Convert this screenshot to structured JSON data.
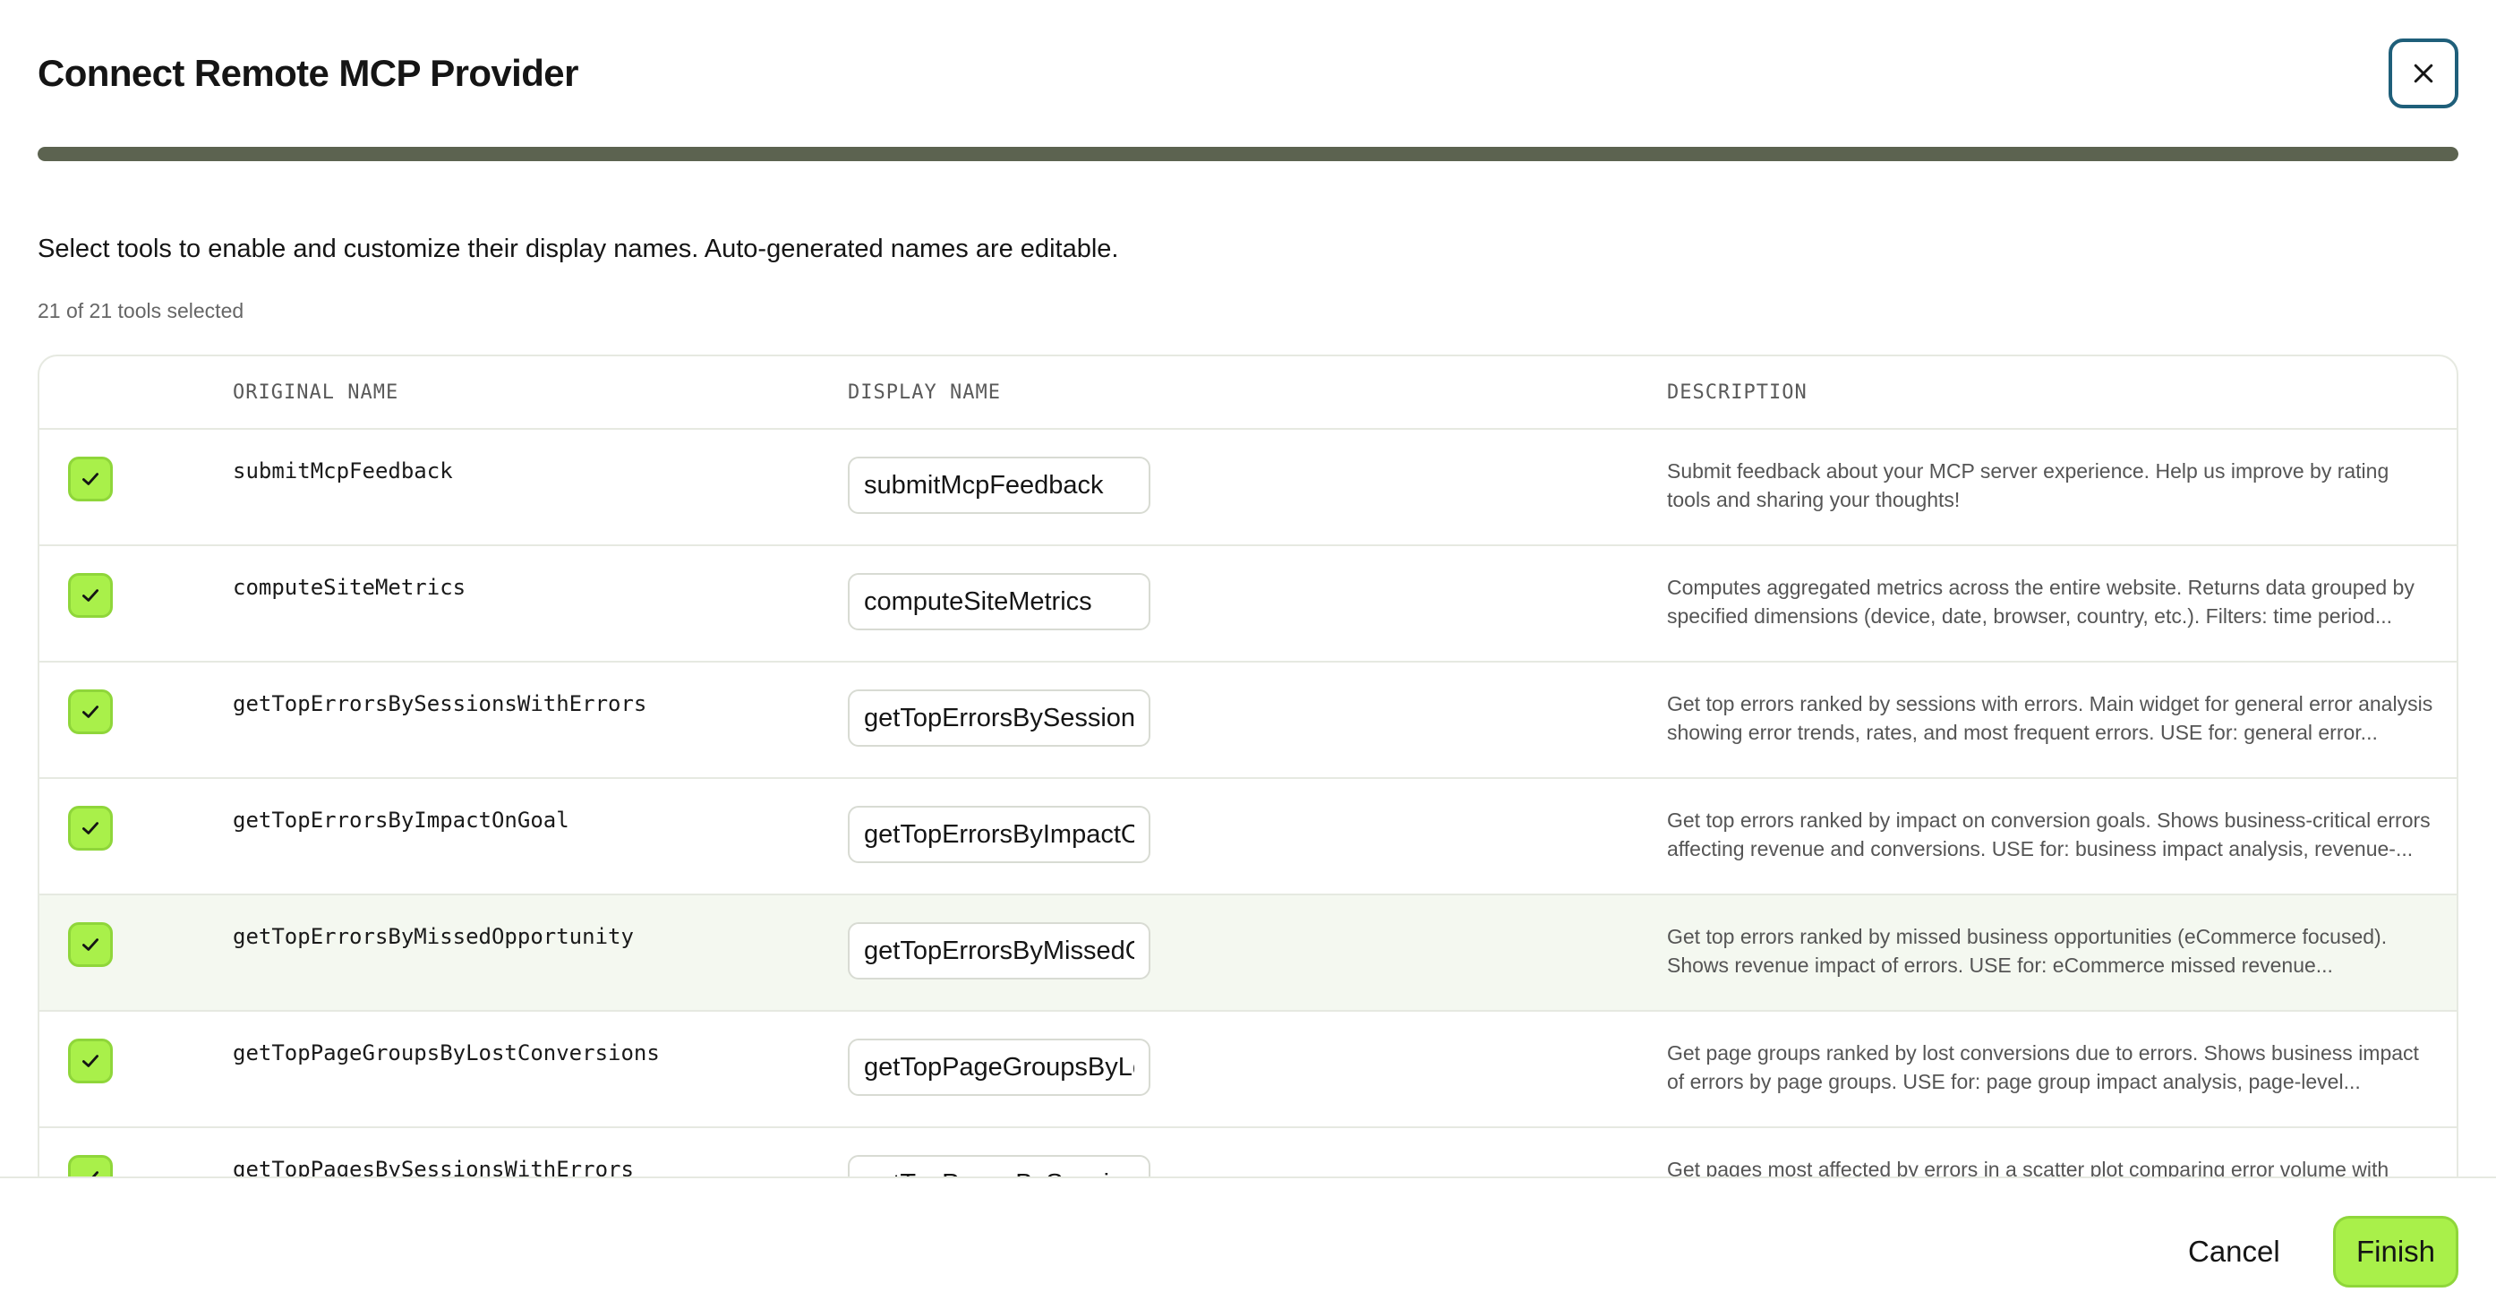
{
  "dialog": {
    "title": "Connect Remote MCP Provider",
    "progress_fraction": 1.0,
    "intro": "Select tools to enable and customize their display names. Auto-generated names are editable.",
    "selected_count": "21 of 21 tools selected"
  },
  "table": {
    "headers": {
      "original": "ORIGINAL NAME",
      "display": "DISPLAY NAME",
      "description": "DESCRIPTION"
    },
    "rows": [
      {
        "checked": true,
        "original": "submitMcpFeedback",
        "display": "submitMcpFeedback",
        "description": "Submit feedback about your MCP server experience. Help us improve by rating tools and sharing your thoughts!"
      },
      {
        "checked": true,
        "original": "computeSiteMetrics",
        "display": "computeSiteMetrics",
        "description": "Computes aggregated metrics across the entire website. Returns data grouped by specified dimensions (device, date, browser, country, etc.). Filters: time period..."
      },
      {
        "checked": true,
        "original": "getTopErrorsBySessionsWithErrors",
        "display": "getTopErrorsBySessionsWithErrors",
        "description": "Get top errors ranked by sessions with errors. Main widget for general error analysis showing error trends, rates, and most frequent errors. USE for: general error..."
      },
      {
        "checked": true,
        "original": "getTopErrorsByImpactOnGoal",
        "display": "getTopErrorsByImpactOnGoal",
        "description": "Get top errors ranked by impact on conversion goals. Shows business-critical errors affecting revenue and conversions. USE for: business impact analysis, revenue-..."
      },
      {
        "checked": true,
        "original": "getTopErrorsByMissedOpportunity",
        "display": "getTopErrorsByMissedOpportunity",
        "description": "Get top errors ranked by missed business opportunities (eCommerce focused). Shows revenue impact of errors. USE for: eCommerce missed revenue..."
      },
      {
        "checked": true,
        "original": "getTopPageGroupsByLostConversions",
        "display": "getTopPageGroupsByLostConversions",
        "description": "Get page groups ranked by lost conversions due to errors. Shows business impact of errors by page groups. USE for: page group impact analysis, page-level..."
      },
      {
        "checked": true,
        "original": "getTopPagesBySessionsWithErrors",
        "display": "getTopPagesBySessionsWithErrors",
        "description": "Get pages most affected by errors in a scatter plot comparing error volume with"
      }
    ]
  },
  "footer": {
    "cancel_label": "Cancel",
    "finish_label": "Finish"
  },
  "colors": {
    "accent": "#a9f04a",
    "progress": "#5c6350",
    "close_border": "#1f5f7a"
  },
  "icons": {
    "close": "close-icon",
    "check": "check-icon"
  }
}
